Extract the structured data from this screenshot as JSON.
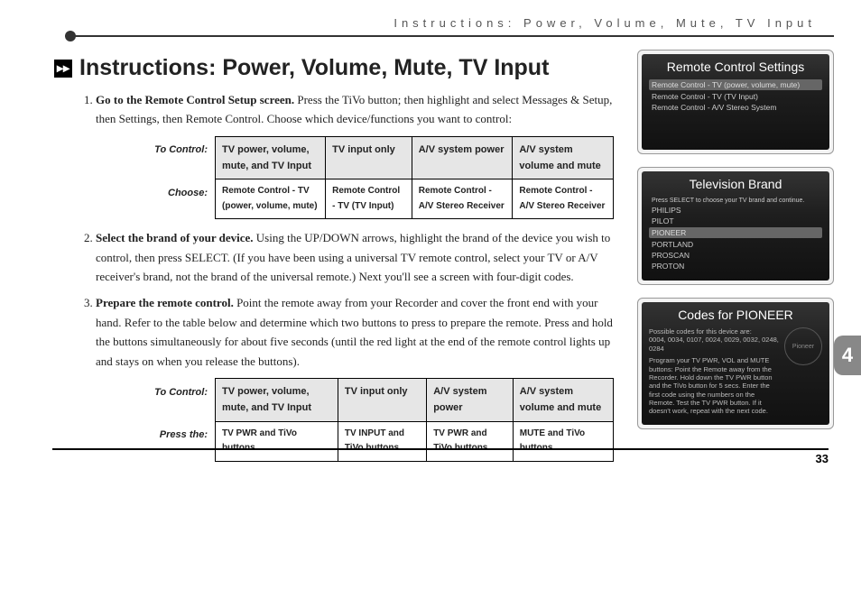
{
  "running_head": "Instructions: Power, Volume, Mute, TV Input",
  "heading": "Instructions: Power, Volume, Mute, TV Input",
  "steps": {
    "s1_bold": "Go to the Remote Control Setup screen.",
    "s1_rest": " Press the TiVo button; then highlight and select Messages & Setup, then Settings, then Remote Control. Choose which device/functions you want to control:",
    "s2_bold": "Select the brand of your device.",
    "s2_rest": " Using the UP/DOWN arrows, highlight the brand of the device you wish to control, then press SELECT. (If you have been using a universal TV remote control, select your TV or A/V receiver's brand, not the brand of the universal remote.) Next you'll see a screen with four-digit codes.",
    "s3_bold": "Prepare the remote control.",
    "s3_rest": " Point the remote away from your Recorder and cover the front end with your hand. Refer to the table below and determine which two buttons to press to prepare the remote. Press and hold the buttons simultaneously for about five seconds (until the red light at the end of the remote control lights up and stays on when you release the buttons)."
  },
  "table1": {
    "row1_label": "To Control:",
    "row2_label": "Choose:",
    "headers": [
      "TV power, volume, mute, and TV Input",
      "TV input only",
      "A/V system power",
      "A/V system volume and mute"
    ],
    "choose": [
      "Remote Control - TV (power, volume, mute)",
      "Remote Control - TV (TV Input)",
      "Remote Control - A/V Stereo Receiver",
      "Remote Control - A/V Stereo Receiver"
    ]
  },
  "table2": {
    "row1_label": "To Control:",
    "row2_label": "Press the:",
    "headers": [
      "TV power, volume, mute, and TV Input",
      "TV input only",
      "A/V system power",
      "A/V system volume and mute"
    ],
    "press": [
      "TV PWR and TiVo buttons",
      "TV INPUT and TiVo buttons",
      "TV PWR and TiVo buttons",
      "MUTE and TiVo buttons"
    ]
  },
  "side": {
    "screen1": {
      "title": "Remote Control Settings",
      "sel": "Remote Control - TV (power, volume, mute)",
      "opt1": "Remote Control - TV (TV Input)",
      "opt2": "Remote Control - A/V Stereo System"
    },
    "screen2": {
      "title": "Television Brand",
      "hint": "Press SELECT to choose your TV brand and continue.",
      "opts": [
        "PHILIPS",
        "PILOT",
        "PIONEER",
        "PORTLAND",
        "PROSCAN",
        "PROTON"
      ],
      "sel_index": 2
    },
    "screen3": {
      "title": "Codes for PIONEER",
      "line1": "Possible codes for this device are:",
      "line2": "0004, 0034, 0107, 0024, 0029, 0032, 0248, 0284",
      "line3": "Program your TV PWR, VOL and MUTE buttons: Point the Remote away from the Recorder. Hold down the TV PWR button and the TiVo button for 5 secs. Enter the first code using the numbers on the Remote. Test the TV PWR button. If it doesn't work, repeat with the next code.",
      "circle": "Pioneer"
    }
  },
  "chapter": "4",
  "page_number": "33"
}
